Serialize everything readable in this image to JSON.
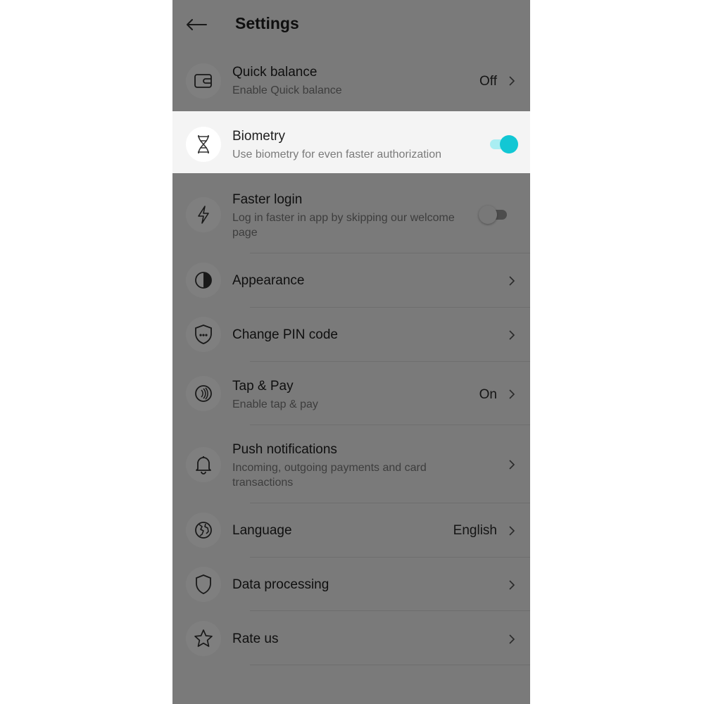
{
  "header": {
    "title": "Settings",
    "back_icon": "arrow-left-icon"
  },
  "settings": [
    {
      "title": "Quick balance",
      "subtitle": "Enable Quick balance",
      "value": "Off",
      "icon": "wallet-icon",
      "control": "chevron"
    },
    {
      "title": "Biometry",
      "subtitle": "Use biometry for even faster authorization",
      "icon": "dna-icon",
      "control": "toggle",
      "toggle_on": true,
      "highlighted": true
    },
    {
      "title": "Faster login",
      "subtitle": "Log in faster in app by skipping our welcome page",
      "icon": "lightning-icon",
      "control": "toggle",
      "toggle_on": false
    },
    {
      "title": "Appearance",
      "icon": "contrast-icon",
      "control": "chevron"
    },
    {
      "title": "Change PIN code",
      "icon": "shield-pin-icon",
      "control": "chevron"
    },
    {
      "title": "Tap & Pay",
      "subtitle": "Enable tap & pay",
      "value": "On",
      "icon": "contactless-icon",
      "control": "chevron"
    },
    {
      "title": "Push notifications",
      "subtitle": "Incoming, outgoing payments and card transactions",
      "icon": "bell-icon",
      "control": "chevron"
    },
    {
      "title": "Language",
      "value": "English",
      "icon": "globe-icon",
      "control": "chevron"
    },
    {
      "title": "Data processing",
      "icon": "shield-icon",
      "control": "chevron"
    },
    {
      "title": "Rate us",
      "icon": "star-icon",
      "control": "chevron"
    }
  ],
  "colors": {
    "accent": "#12c7d4",
    "overlay": "#000000",
    "background": "#f4f4f4"
  }
}
